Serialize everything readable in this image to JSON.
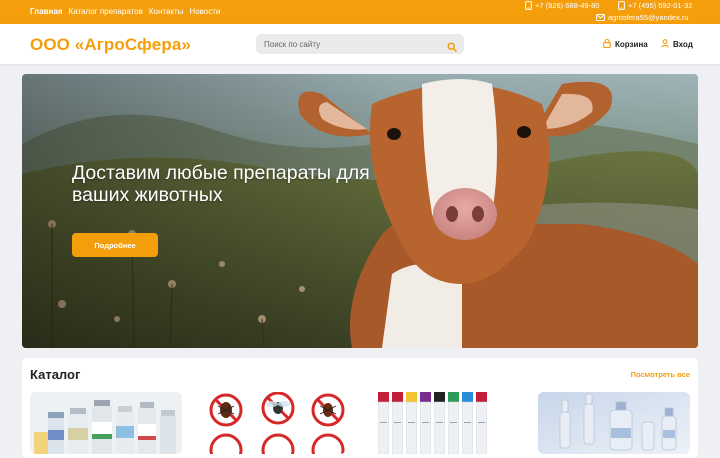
{
  "topbar": {
    "nav": [
      "Главная",
      "Каталог препаратов",
      "Контакты",
      "Новости"
    ],
    "phone1": "+7 (926) 688-49-80",
    "phone2": "+7 (495) 592-01-32",
    "email": "agrosfera55@yandex.ru"
  },
  "header": {
    "logo": "ООО «АгроСфера»",
    "search_placeholder": "Поиск по сайту",
    "cart_label": "Корзина",
    "login_label": "Вход"
  },
  "hero": {
    "title": "Доставим любые препараты для ваших животных",
    "button_label": "Подробнее"
  },
  "catalog": {
    "title": "Каталог",
    "see_all": "Посмотреть все"
  },
  "colors": {
    "accent": "#f59e0b",
    "page_bg": "#eef0f3"
  },
  "icons": [
    "phone-icon",
    "mail-icon",
    "search-icon",
    "lock-icon",
    "user-icon"
  ]
}
